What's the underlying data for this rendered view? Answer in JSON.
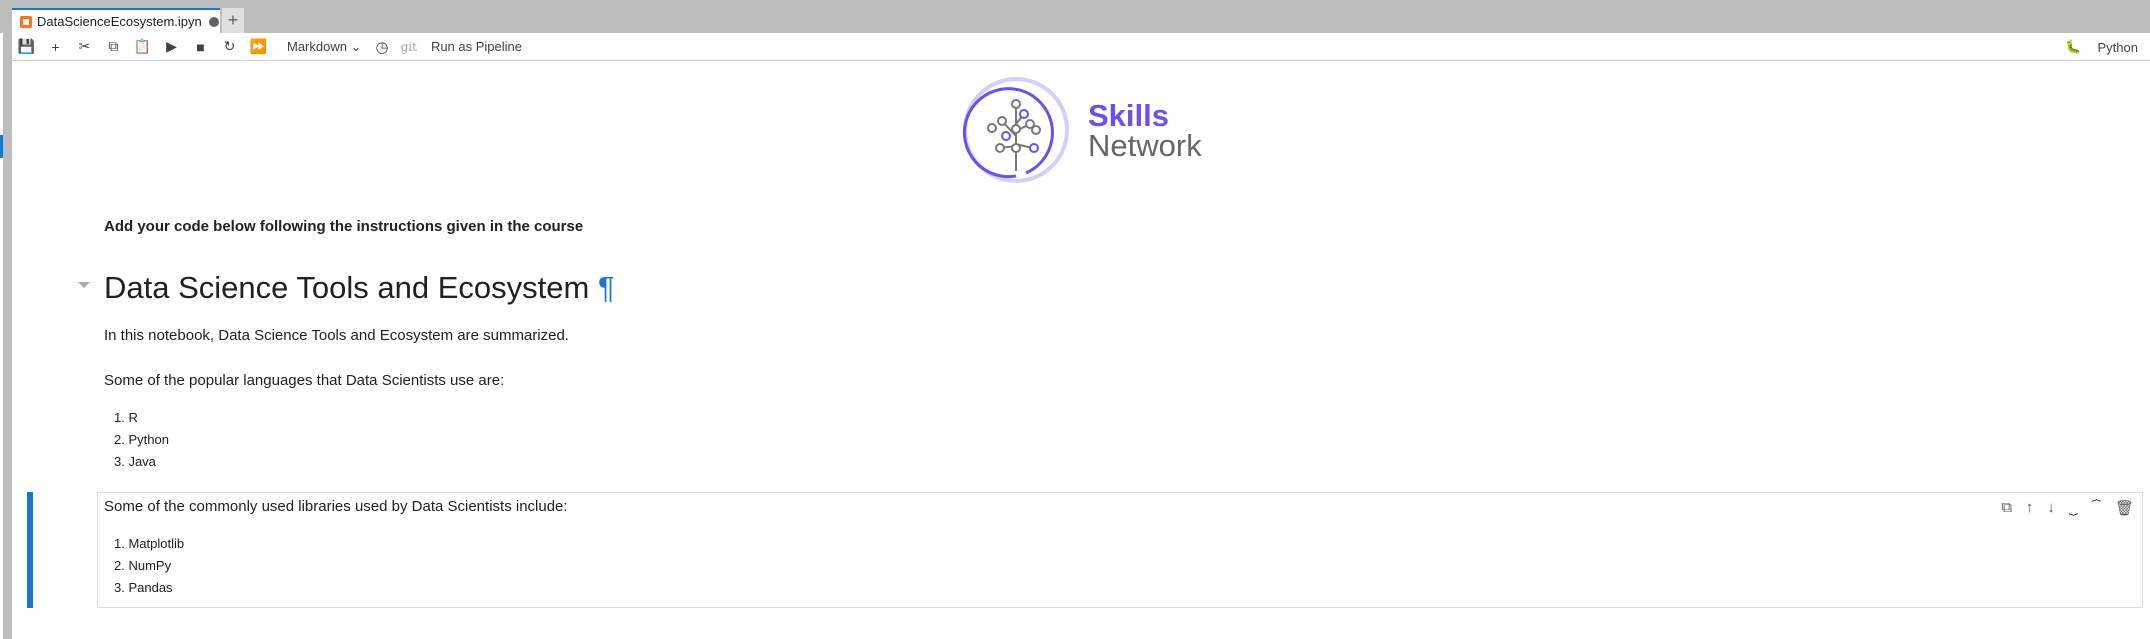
{
  "tab": {
    "title": "DataScienceEcosystem.ipyn",
    "add": "+"
  },
  "toolbar": {
    "icons": [
      "save-icon",
      "add-icon",
      "cut-icon",
      "copy-icon",
      "paste-icon",
      "run-icon",
      "stop-icon",
      "restart-icon",
      "fast-forward-icon"
    ],
    "cell_type": "Markdown",
    "git": "git",
    "run_pipeline": "Run as Pipeline",
    "kernel": "Python"
  },
  "logo": {
    "line1": "Skills",
    "line2": "Network",
    "accent": "#6c4ff0"
  },
  "cells": {
    "instruction": "Add your code below following the instructions given in the course",
    "heading": "Data Science Tools and Ecosystem",
    "pilcrow": "¶",
    "intro": "In this notebook, Data Science Tools and Ecosystem are summarized.",
    "languages_intro": "Some of the popular languages that Data Scientists use are:",
    "languages": [
      "1. R",
      "2. Python",
      "3. Java"
    ],
    "libraries_intro": "Some of the commonly used libraries used by Data Scientists include:",
    "libraries": [
      "1. Matplotlib",
      "2. NumPy",
      "3. Pandas"
    ]
  },
  "cell_actions": [
    "duplicate-icon",
    "move-up-icon",
    "move-down-icon",
    "insert-above-icon",
    "insert-below-icon",
    "delete-icon"
  ]
}
